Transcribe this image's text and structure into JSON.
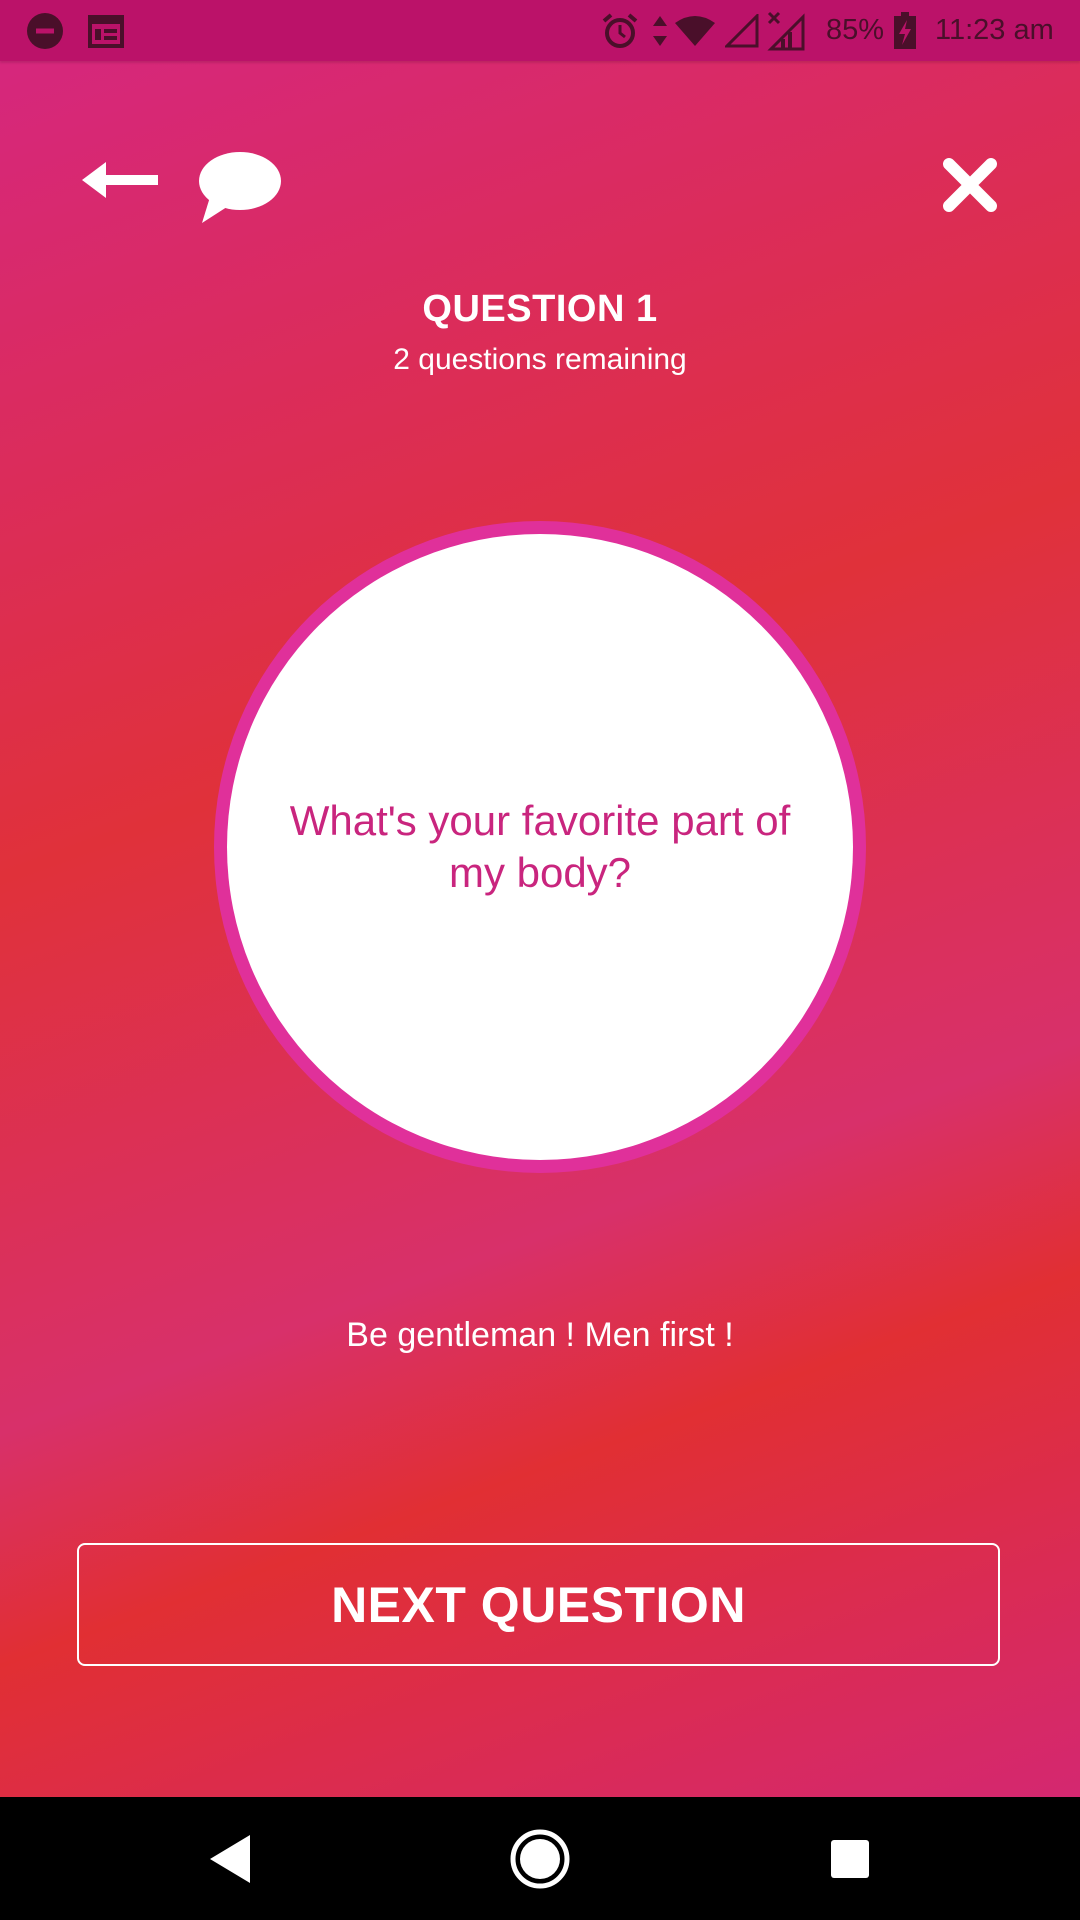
{
  "status_bar": {
    "battery_percent": "85%",
    "time": "11:23 am",
    "icons": [
      "do-not-disturb-icon",
      "calendar-icon",
      "alarm-icon",
      "data-transfer-icon",
      "wifi-icon",
      "signal-empty-icon",
      "signal-no-service-icon",
      "battery-charging-icon"
    ]
  },
  "header": {
    "icons": [
      "back-arrow-icon",
      "chat-bubble-icon",
      "close-icon"
    ]
  },
  "question": {
    "title": "QUESTION 1",
    "remaining": "2 questions remaining",
    "text": "What's your favorite part of my body?"
  },
  "hint": "Be gentleman ! Men first !",
  "next_button": {
    "label": "NEXT QUESTION"
  },
  "nav_bar": {
    "icons": [
      "nav-back-icon",
      "nav-home-icon",
      "nav-recents-icon"
    ]
  },
  "colors": {
    "status_bar": "#bb1269",
    "gradient_pink": "#d52682",
    "gradient_red": "#e0313a",
    "circle_ring": "#e0309a",
    "question_text": "#c9257e",
    "nav_bar": "#000000"
  }
}
